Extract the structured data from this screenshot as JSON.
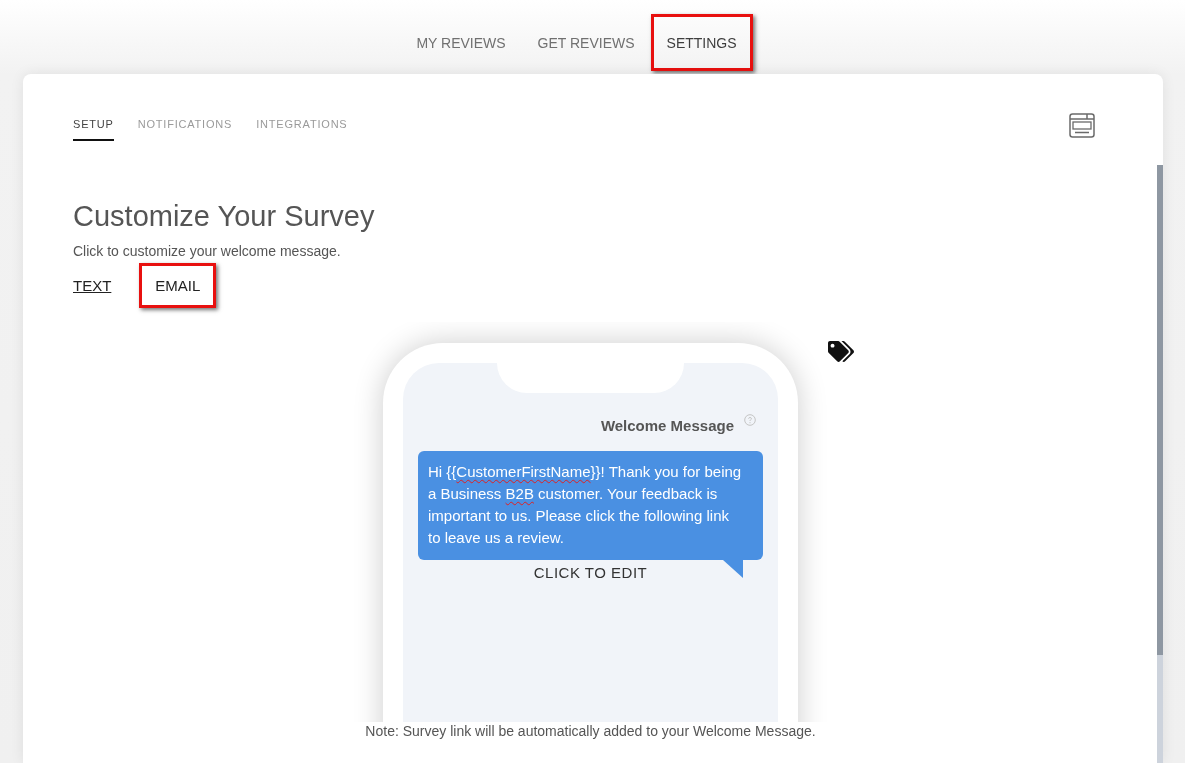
{
  "top_nav": [
    {
      "label": "MY REVIEWS",
      "selected": false,
      "highlighted": false
    },
    {
      "label": "GET REVIEWS",
      "selected": false,
      "highlighted": false
    },
    {
      "label": "SETTINGS",
      "selected": true,
      "highlighted": true
    }
  ],
  "settings_tabs": [
    {
      "label": "SETUP",
      "selected": true
    },
    {
      "label": "NOTIFICATIONS",
      "selected": false
    },
    {
      "label": "INTEGRATIONS",
      "selected": false
    }
  ],
  "section": {
    "title": "Customize Your Survey",
    "subtitle": "Click to customize your welcome message."
  },
  "message_types": [
    {
      "label": "TEXT",
      "selected": true,
      "highlighted": false
    },
    {
      "label": "EMAIL",
      "selected": false,
      "highlighted": true
    }
  ],
  "preview": {
    "heading": "Welcome Message",
    "message": [
      {
        "text": "Hi {{",
        "misspelled": false
      },
      {
        "text": "CustomerFirstName",
        "misspelled": true
      },
      {
        "text": "}}! Thank you for being a Business ",
        "misspelled": false
      },
      {
        "text": "B2B",
        "misspelled": true
      },
      {
        "text": " customer. Your feedback is important to us. Please click the following link to leave us a review.",
        "misspelled": false
      }
    ],
    "edit_label": "CLICK TO EDIT"
  },
  "note": "Note: Survey link will be automatically added to your Welcome Message."
}
